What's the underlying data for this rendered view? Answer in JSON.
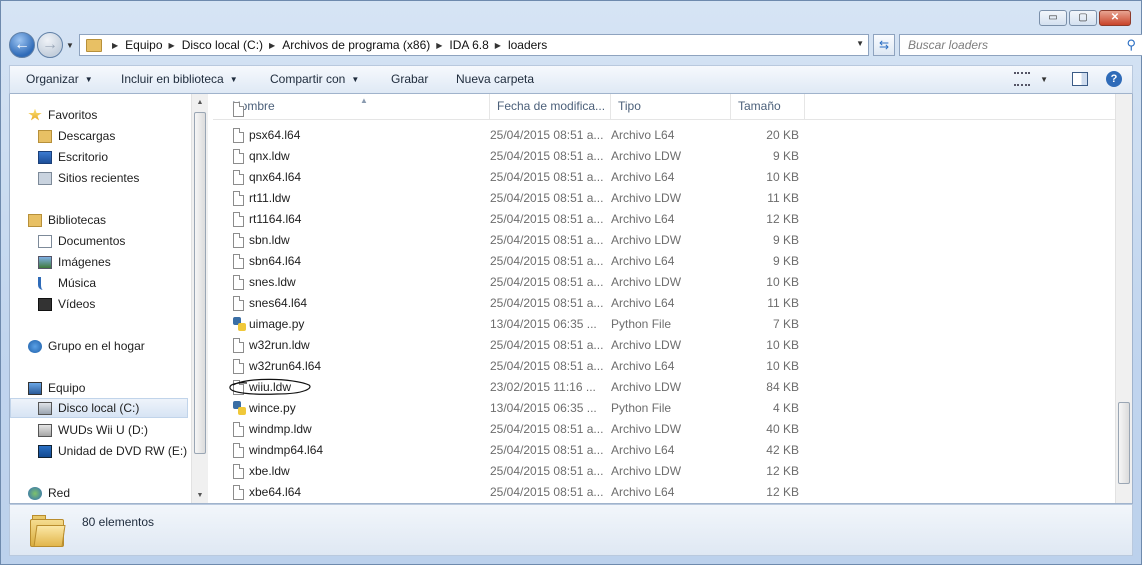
{
  "window": {
    "controls": {
      "minimize": "▭",
      "maximize": "▢",
      "close": "✕"
    }
  },
  "address": {
    "breadcrumbs": [
      "Equipo",
      "Disco local (C:)",
      "Archivos de programa (x86)",
      "IDA 6.8",
      "loaders"
    ]
  },
  "search": {
    "placeholder": "Buscar loaders"
  },
  "toolbar": {
    "organize": "Organizar",
    "include_in_library": "Incluir en biblioteca",
    "share_with": "Compartir con",
    "burn": "Grabar",
    "new_folder": "Nueva carpeta",
    "help": "?"
  },
  "nav": {
    "items": [
      {
        "label": "Favoritos",
        "icon": "star-icon"
      },
      {
        "label": "Descargas",
        "icon": "downloads-folder-icon"
      },
      {
        "label": "Escritorio",
        "icon": "desktop-icon"
      },
      {
        "label": "Sitios recientes",
        "icon": "recent-places-icon"
      },
      {
        "label": "Bibliotecas",
        "icon": "libraries-icon"
      },
      {
        "label": "Documentos",
        "icon": "documents-icon"
      },
      {
        "label": "Imágenes",
        "icon": "pictures-icon"
      },
      {
        "label": "Música",
        "icon": "music-icon"
      },
      {
        "label": "Vídeos",
        "icon": "videos-icon"
      },
      {
        "label": "Grupo en el hogar",
        "icon": "homegroup-icon"
      },
      {
        "label": "Equipo",
        "icon": "computer-icon"
      },
      {
        "label": "Disco local (C:)",
        "icon": "local-disk-icon"
      },
      {
        "label": "WUDs Wii U (D:)",
        "icon": "drive-icon"
      },
      {
        "label": "Unidad de DVD RW (E:) B",
        "icon": "dvd-drive-icon"
      },
      {
        "label": "Red",
        "icon": "network-icon"
      }
    ]
  },
  "columns": {
    "name": "Nombre",
    "date": "Fecha de modifica...",
    "type": "Tipo",
    "size": "Tamaño"
  },
  "files": [
    {
      "name": "psx64.l64",
      "date": "25/04/2015 08:51 a...",
      "type": "Archivo L64",
      "size": "20 KB",
      "icon": "file-icon"
    },
    {
      "name": "qnx.ldw",
      "date": "25/04/2015 08:51 a...",
      "type": "Archivo LDW",
      "size": "9 KB",
      "icon": "file-icon"
    },
    {
      "name": "qnx64.l64",
      "date": "25/04/2015 08:51 a...",
      "type": "Archivo L64",
      "size": "10 KB",
      "icon": "file-icon"
    },
    {
      "name": "rt11.ldw",
      "date": "25/04/2015 08:51 a...",
      "type": "Archivo LDW",
      "size": "11 KB",
      "icon": "file-icon"
    },
    {
      "name": "rt1164.l64",
      "date": "25/04/2015 08:51 a...",
      "type": "Archivo L64",
      "size": "12 KB",
      "icon": "file-icon"
    },
    {
      "name": "sbn.ldw",
      "date": "25/04/2015 08:51 a...",
      "type": "Archivo LDW",
      "size": "9 KB",
      "icon": "file-icon"
    },
    {
      "name": "sbn64.l64",
      "date": "25/04/2015 08:51 a...",
      "type": "Archivo L64",
      "size": "9 KB",
      "icon": "file-icon"
    },
    {
      "name": "snes.ldw",
      "date": "25/04/2015 08:51 a...",
      "type": "Archivo LDW",
      "size": "10 KB",
      "icon": "file-icon"
    },
    {
      "name": "snes64.l64",
      "date": "25/04/2015 08:51 a...",
      "type": "Archivo L64",
      "size": "11 KB",
      "icon": "file-icon"
    },
    {
      "name": "uimage.py",
      "date": "13/04/2015 06:35 ...",
      "type": "Python File",
      "size": "7 KB",
      "icon": "python-file-icon"
    },
    {
      "name": "w32run.ldw",
      "date": "25/04/2015 08:51 a...",
      "type": "Archivo LDW",
      "size": "10 KB",
      "icon": "file-icon"
    },
    {
      "name": "w32run64.l64",
      "date": "25/04/2015 08:51 a...",
      "type": "Archivo L64",
      "size": "10 KB",
      "icon": "file-icon"
    },
    {
      "name": "wiiu.ldw",
      "date": "23/02/2015 11:16 ...",
      "type": "Archivo LDW",
      "size": "84 KB",
      "icon": "file-icon",
      "circled": true
    },
    {
      "name": "wince.py",
      "date": "13/04/2015 06:35 ...",
      "type": "Python File",
      "size": "4 KB",
      "icon": "python-file-icon"
    },
    {
      "name": "windmp.ldw",
      "date": "25/04/2015 08:51 a...",
      "type": "Archivo LDW",
      "size": "40 KB",
      "icon": "file-icon"
    },
    {
      "name": "windmp64.l64",
      "date": "25/04/2015 08:51 a...",
      "type": "Archivo L64",
      "size": "42 KB",
      "icon": "file-icon"
    },
    {
      "name": "xbe.ldw",
      "date": "25/04/2015 08:51 a...",
      "type": "Archivo LDW",
      "size": "12 KB",
      "icon": "file-icon"
    },
    {
      "name": "xbe64.l64",
      "date": "25/04/2015 08:51 a...",
      "type": "Archivo L64",
      "size": "12 KB",
      "icon": "file-icon"
    }
  ],
  "status": {
    "item_count": "80 elementos"
  }
}
